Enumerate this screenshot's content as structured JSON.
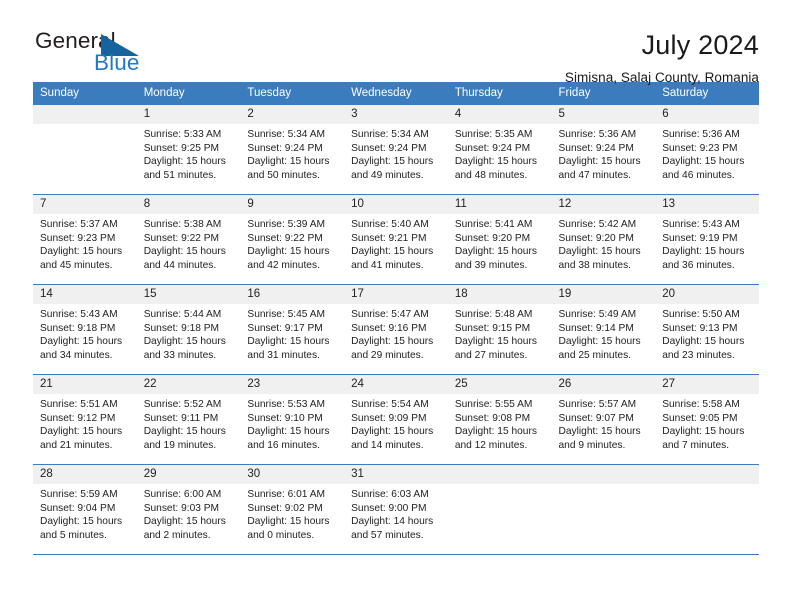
{
  "brand": {
    "name_part1": "General",
    "name_part2": "Blue",
    "accent_color": "#2079c7",
    "triangle_color": "#15639f"
  },
  "header": {
    "title": "July 2024",
    "subtitle": "Simisna, Salaj County, Romania"
  },
  "calendar": {
    "header_bg": "#3a7cbe",
    "daynum_bg": "#f0f0f0",
    "weekdays": [
      "Sunday",
      "Monday",
      "Tuesday",
      "Wednesday",
      "Thursday",
      "Friday",
      "Saturday"
    ],
    "weeks": [
      [
        {
          "day": "",
          "blank": true
        },
        {
          "day": "1",
          "sunrise": "Sunrise: 5:33 AM",
          "sunset": "Sunset: 9:25 PM",
          "daylight1": "Daylight: 15 hours",
          "daylight2": "and 51 minutes."
        },
        {
          "day": "2",
          "sunrise": "Sunrise: 5:34 AM",
          "sunset": "Sunset: 9:24 PM",
          "daylight1": "Daylight: 15 hours",
          "daylight2": "and 50 minutes."
        },
        {
          "day": "3",
          "sunrise": "Sunrise: 5:34 AM",
          "sunset": "Sunset: 9:24 PM",
          "daylight1": "Daylight: 15 hours",
          "daylight2": "and 49 minutes."
        },
        {
          "day": "4",
          "sunrise": "Sunrise: 5:35 AM",
          "sunset": "Sunset: 9:24 PM",
          "daylight1": "Daylight: 15 hours",
          "daylight2": "and 48 minutes."
        },
        {
          "day": "5",
          "sunrise": "Sunrise: 5:36 AM",
          "sunset": "Sunset: 9:24 PM",
          "daylight1": "Daylight: 15 hours",
          "daylight2": "and 47 minutes."
        },
        {
          "day": "6",
          "sunrise": "Sunrise: 5:36 AM",
          "sunset": "Sunset: 9:23 PM",
          "daylight1": "Daylight: 15 hours",
          "daylight2": "and 46 minutes."
        }
      ],
      [
        {
          "day": "7",
          "sunrise": "Sunrise: 5:37 AM",
          "sunset": "Sunset: 9:23 PM",
          "daylight1": "Daylight: 15 hours",
          "daylight2": "and 45 minutes."
        },
        {
          "day": "8",
          "sunrise": "Sunrise: 5:38 AM",
          "sunset": "Sunset: 9:22 PM",
          "daylight1": "Daylight: 15 hours",
          "daylight2": "and 44 minutes."
        },
        {
          "day": "9",
          "sunrise": "Sunrise: 5:39 AM",
          "sunset": "Sunset: 9:22 PM",
          "daylight1": "Daylight: 15 hours",
          "daylight2": "and 42 minutes."
        },
        {
          "day": "10",
          "sunrise": "Sunrise: 5:40 AM",
          "sunset": "Sunset: 9:21 PM",
          "daylight1": "Daylight: 15 hours",
          "daylight2": "and 41 minutes."
        },
        {
          "day": "11",
          "sunrise": "Sunrise: 5:41 AM",
          "sunset": "Sunset: 9:20 PM",
          "daylight1": "Daylight: 15 hours",
          "daylight2": "and 39 minutes."
        },
        {
          "day": "12",
          "sunrise": "Sunrise: 5:42 AM",
          "sunset": "Sunset: 9:20 PM",
          "daylight1": "Daylight: 15 hours",
          "daylight2": "and 38 minutes."
        },
        {
          "day": "13",
          "sunrise": "Sunrise: 5:43 AM",
          "sunset": "Sunset: 9:19 PM",
          "daylight1": "Daylight: 15 hours",
          "daylight2": "and 36 minutes."
        }
      ],
      [
        {
          "day": "14",
          "sunrise": "Sunrise: 5:43 AM",
          "sunset": "Sunset: 9:18 PM",
          "daylight1": "Daylight: 15 hours",
          "daylight2": "and 34 minutes."
        },
        {
          "day": "15",
          "sunrise": "Sunrise: 5:44 AM",
          "sunset": "Sunset: 9:18 PM",
          "daylight1": "Daylight: 15 hours",
          "daylight2": "and 33 minutes."
        },
        {
          "day": "16",
          "sunrise": "Sunrise: 5:45 AM",
          "sunset": "Sunset: 9:17 PM",
          "daylight1": "Daylight: 15 hours",
          "daylight2": "and 31 minutes."
        },
        {
          "day": "17",
          "sunrise": "Sunrise: 5:47 AM",
          "sunset": "Sunset: 9:16 PM",
          "daylight1": "Daylight: 15 hours",
          "daylight2": "and 29 minutes."
        },
        {
          "day": "18",
          "sunrise": "Sunrise: 5:48 AM",
          "sunset": "Sunset: 9:15 PM",
          "daylight1": "Daylight: 15 hours",
          "daylight2": "and 27 minutes."
        },
        {
          "day": "19",
          "sunrise": "Sunrise: 5:49 AM",
          "sunset": "Sunset: 9:14 PM",
          "daylight1": "Daylight: 15 hours",
          "daylight2": "and 25 minutes."
        },
        {
          "day": "20",
          "sunrise": "Sunrise: 5:50 AM",
          "sunset": "Sunset: 9:13 PM",
          "daylight1": "Daylight: 15 hours",
          "daylight2": "and 23 minutes."
        }
      ],
      [
        {
          "day": "21",
          "sunrise": "Sunrise: 5:51 AM",
          "sunset": "Sunset: 9:12 PM",
          "daylight1": "Daylight: 15 hours",
          "daylight2": "and 21 minutes."
        },
        {
          "day": "22",
          "sunrise": "Sunrise: 5:52 AM",
          "sunset": "Sunset: 9:11 PM",
          "daylight1": "Daylight: 15 hours",
          "daylight2": "and 19 minutes."
        },
        {
          "day": "23",
          "sunrise": "Sunrise: 5:53 AM",
          "sunset": "Sunset: 9:10 PM",
          "daylight1": "Daylight: 15 hours",
          "daylight2": "and 16 minutes."
        },
        {
          "day": "24",
          "sunrise": "Sunrise: 5:54 AM",
          "sunset": "Sunset: 9:09 PM",
          "daylight1": "Daylight: 15 hours",
          "daylight2": "and 14 minutes."
        },
        {
          "day": "25",
          "sunrise": "Sunrise: 5:55 AM",
          "sunset": "Sunset: 9:08 PM",
          "daylight1": "Daylight: 15 hours",
          "daylight2": "and 12 minutes."
        },
        {
          "day": "26",
          "sunrise": "Sunrise: 5:57 AM",
          "sunset": "Sunset: 9:07 PM",
          "daylight1": "Daylight: 15 hours",
          "daylight2": "and 9 minutes."
        },
        {
          "day": "27",
          "sunrise": "Sunrise: 5:58 AM",
          "sunset": "Sunset: 9:05 PM",
          "daylight1": "Daylight: 15 hours",
          "daylight2": "and 7 minutes."
        }
      ],
      [
        {
          "day": "28",
          "sunrise": "Sunrise: 5:59 AM",
          "sunset": "Sunset: 9:04 PM",
          "daylight1": "Daylight: 15 hours",
          "daylight2": "and 5 minutes."
        },
        {
          "day": "29",
          "sunrise": "Sunrise: 6:00 AM",
          "sunset": "Sunset: 9:03 PM",
          "daylight1": "Daylight: 15 hours",
          "daylight2": "and 2 minutes."
        },
        {
          "day": "30",
          "sunrise": "Sunrise: 6:01 AM",
          "sunset": "Sunset: 9:02 PM",
          "daylight1": "Daylight: 15 hours",
          "daylight2": "and 0 minutes."
        },
        {
          "day": "31",
          "sunrise": "Sunrise: 6:03 AM",
          "sunset": "Sunset: 9:00 PM",
          "daylight1": "Daylight: 14 hours",
          "daylight2": "and 57 minutes."
        },
        {
          "day": "",
          "blank": true
        },
        {
          "day": "",
          "blank": true
        },
        {
          "day": "",
          "blank": true
        }
      ]
    ]
  }
}
